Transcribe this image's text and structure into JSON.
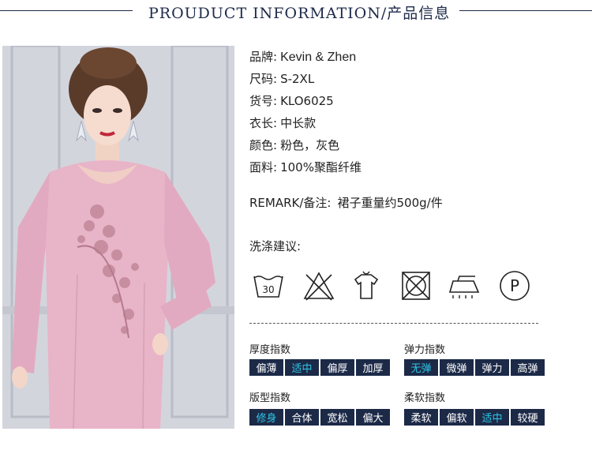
{
  "header": {
    "title": "PROUDUCT INFORMATION/产品信息"
  },
  "specs": [
    {
      "label": "品牌:",
      "value": "Kevin & Zhen"
    },
    {
      "label": "尺码:",
      "value": "S-2XL"
    },
    {
      "label": "货号:",
      "value": "KLO6025"
    },
    {
      "label": "衣长:",
      "value": "中长款"
    },
    {
      "label": "颜色:",
      "value": "粉色，灰色"
    },
    {
      "label": "面料:",
      "value": "100%聚酯纤维"
    }
  ],
  "remark": {
    "label": "REMARK/备注:",
    "value": "裙子重量约500g/件"
  },
  "wash": {
    "title": "洗涤建议:",
    "icons": [
      "wash-30-icon",
      "no-bleach-icon",
      "hang-dry-icon",
      "no-tumble-dry-icon",
      "iron-icon",
      "dry-clean-p-icon"
    ],
    "wash_temp": "30",
    "dry_clean_letter": "P"
  },
  "indices": {
    "thickness": {
      "title": "厚度指数",
      "options": [
        "偏薄",
        "适中",
        "偏厚",
        "加厚"
      ],
      "selected": 1
    },
    "elasticity": {
      "title": "弹力指数",
      "options": [
        "无弹",
        "微弹",
        "弹力",
        "高弹"
      ],
      "selected": 0
    },
    "fit": {
      "title": "版型指数",
      "options": [
        "修身",
        "合体",
        "宽松",
        "偏大"
      ],
      "selected": 0
    },
    "softness": {
      "title": "柔软指数",
      "options": [
        "柔软",
        "偏软",
        "适中",
        "较硬"
      ],
      "selected": 2
    }
  },
  "colors": {
    "navy": "#1c2a48",
    "highlight": "#2ec6e6",
    "dress_pink": "#e8b4c8"
  }
}
